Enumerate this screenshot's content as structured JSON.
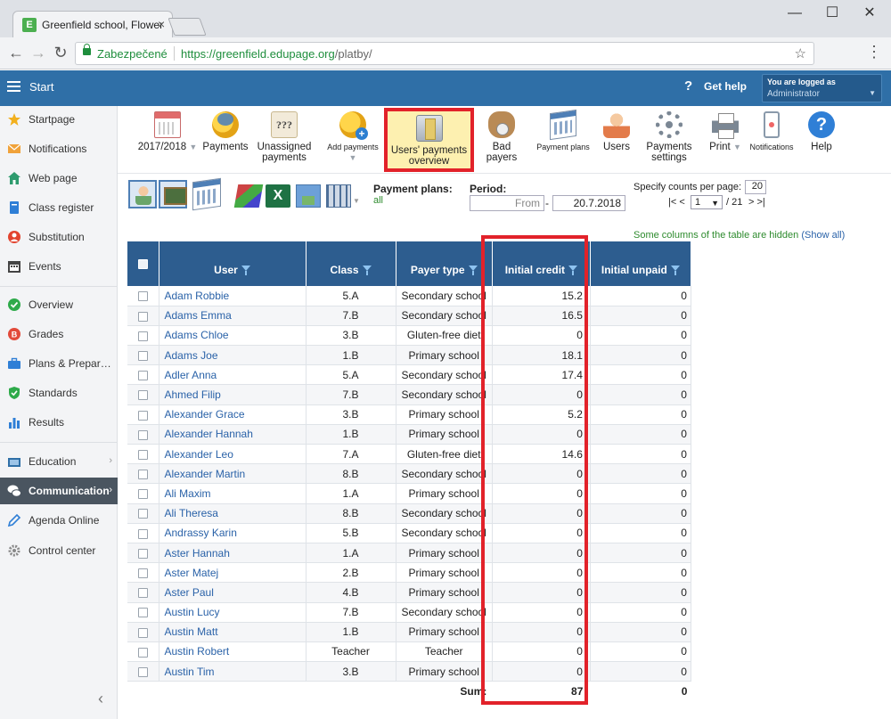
{
  "browser": {
    "tab_title": "Greenfield school, Flower",
    "tab_favicon": "E",
    "tab_close": "×",
    "secure_label": "Zabezpečené",
    "url_host": "https://greenfield.edupage.org",
    "url_path": "/platby/",
    "controls": {
      "minimize": "—",
      "maximize": "☐",
      "close": "✕"
    },
    "nav": {
      "back": "←",
      "forward": "→",
      "reload": "↻",
      "star": "☆",
      "menu": "⋮"
    }
  },
  "header": {
    "start_label": "Start",
    "help_icon": "?",
    "help_label": "Get help",
    "login_title": "You are logged as",
    "login_user": "Administrator",
    "login_caret": "▼"
  },
  "sidebar": {
    "items": [
      {
        "label": "Startpage",
        "icon": "star-icon",
        "color": "#f2b01e"
      },
      {
        "label": "Notifications",
        "icon": "envelope-icon",
        "color": "#f0a23a"
      },
      {
        "label": "Web page",
        "icon": "home-icon",
        "color": "#2e9b6e"
      },
      {
        "label": "Class register",
        "icon": "book-icon",
        "color": "#2f7fd6"
      },
      {
        "label": "Substitution",
        "icon": "person-icon",
        "color": "#e2442f"
      },
      {
        "label": "Events",
        "icon": "calendar-icon",
        "color": "#444"
      },
      {
        "label": "Overview",
        "icon": "check-circle-icon",
        "color": "#2eaa4a"
      },
      {
        "label": "Grades",
        "icon": "grades-icon",
        "color": "#e24a3a"
      },
      {
        "label": "Plans & Prepar…",
        "icon": "briefcase-icon",
        "color": "#2f7fd6"
      },
      {
        "label": "Standards",
        "icon": "shield-check-icon",
        "color": "#2eaa4a"
      },
      {
        "label": "Results",
        "icon": "bar-chart-icon",
        "color": "#2f7fd6"
      },
      {
        "label": "Education",
        "icon": "education-icon",
        "color": "#2f6fa7"
      },
      {
        "label": "Communication",
        "icon": "chat-icon",
        "color": "#ffffff"
      },
      {
        "label": "Agenda Online",
        "icon": "pen-icon",
        "color": "#2f7fd6"
      },
      {
        "label": "Control center",
        "icon": "gear-icon",
        "color": "#888"
      }
    ],
    "chevron": "›",
    "collapse": "‹"
  },
  "toolbar": {
    "year": "2017/2018",
    "year_caret": "▼",
    "payments": "Payments",
    "unassigned": "Unassigned payments",
    "unassigned_icon_text": "???",
    "add_payments": "Add payments",
    "add_caret": "▼",
    "users_overview": "Users' payments overview",
    "bad_payers": "Bad payers",
    "payment_plans": "Payment plans",
    "users": "Users",
    "payments_settings": "Payments settings",
    "print": "Print",
    "print_caret": "▼",
    "notifications": "Notifications",
    "help": "Help",
    "help_icon": "?"
  },
  "filters": {
    "excel_icon_text": "X",
    "grid_caret": "▼",
    "payment_plans_label": "Payment plans:",
    "payment_plans_value": "all",
    "period_label": "Period:",
    "from_value": "From",
    "dash": "-",
    "to_value": "20.7.2018",
    "counts_label": "Specify counts per page:",
    "counts_value": "20",
    "pager_first": "|<  <",
    "page_value": "1",
    "page_caret": "▼",
    "page_total": "/ 21",
    "pager_last": ">  >|",
    "hidden_note": "Some columns of the table are hidden",
    "show_all": "(Show all)"
  },
  "table": {
    "columns": [
      "User",
      "Class",
      "Payer type",
      "Initial credit",
      "Initial unpaid"
    ],
    "rows": [
      {
        "user": "Adam Robbie",
        "class": "5.A",
        "payer": "Secondary school",
        "credit": "15.2",
        "unpaid": "0"
      },
      {
        "user": "Adams Emma",
        "class": "7.B",
        "payer": "Secondary school",
        "credit": "16.5",
        "unpaid": "0"
      },
      {
        "user": "Adams Chloe",
        "class": "3.B",
        "payer": "Gluten-free diet",
        "credit": "0",
        "unpaid": "0"
      },
      {
        "user": "Adams Joe",
        "class": "1.B",
        "payer": "Primary school",
        "credit": "18.1",
        "unpaid": "0"
      },
      {
        "user": "Adler Anna",
        "class": "5.A",
        "payer": "Secondary school",
        "credit": "17.4",
        "unpaid": "0"
      },
      {
        "user": "Ahmed Filip",
        "class": "7.B",
        "payer": "Secondary school",
        "credit": "0",
        "unpaid": "0"
      },
      {
        "user": "Alexander Grace",
        "class": "3.B",
        "payer": "Primary school",
        "credit": "5.2",
        "unpaid": "0"
      },
      {
        "user": "Alexander Hannah",
        "class": "1.B",
        "payer": "Primary school",
        "credit": "0",
        "unpaid": "0"
      },
      {
        "user": "Alexander Leo",
        "class": "7.A",
        "payer": "Gluten-free diet",
        "credit": "14.6",
        "unpaid": "0"
      },
      {
        "user": "Alexander Martin",
        "class": "8.B",
        "payer": "Secondary school",
        "credit": "0",
        "unpaid": "0"
      },
      {
        "user": "Ali Maxim",
        "class": "1.A",
        "payer": "Primary school",
        "credit": "0",
        "unpaid": "0"
      },
      {
        "user": "Ali Theresa",
        "class": "8.B",
        "payer": "Secondary school",
        "credit": "0",
        "unpaid": "0"
      },
      {
        "user": "Andrassy Karin",
        "class": "5.B",
        "payer": "Secondary school",
        "credit": "0",
        "unpaid": "0"
      },
      {
        "user": "Aster Hannah",
        "class": "1.A",
        "payer": "Primary school",
        "credit": "0",
        "unpaid": "0"
      },
      {
        "user": "Aster Matej",
        "class": "2.B",
        "payer": "Primary school",
        "credit": "0",
        "unpaid": "0"
      },
      {
        "user": "Aster Paul",
        "class": "4.B",
        "payer": "Primary school",
        "credit": "0",
        "unpaid": "0"
      },
      {
        "user": "Austin Lucy",
        "class": "7.B",
        "payer": "Secondary school",
        "credit": "0",
        "unpaid": "0"
      },
      {
        "user": "Austin Matt",
        "class": "1.B",
        "payer": "Primary school",
        "credit": "0",
        "unpaid": "0"
      },
      {
        "user": "Austin Robert",
        "class": "Teacher",
        "payer": "Teacher",
        "credit": "0",
        "unpaid": "0"
      },
      {
        "user": "Austin Tim",
        "class": "3.B",
        "payer": "Primary school",
        "credit": "0",
        "unpaid": "0"
      }
    ],
    "sum_label": "Sum:",
    "sum_credit": "87",
    "sum_unpaid": "0"
  },
  "colors": {
    "appbar": "#2f6fa7",
    "table_header": "#2d5d8f",
    "highlight_border": "#e2222a",
    "link": "#2a62a8",
    "green_text": "#2e8b2e"
  }
}
